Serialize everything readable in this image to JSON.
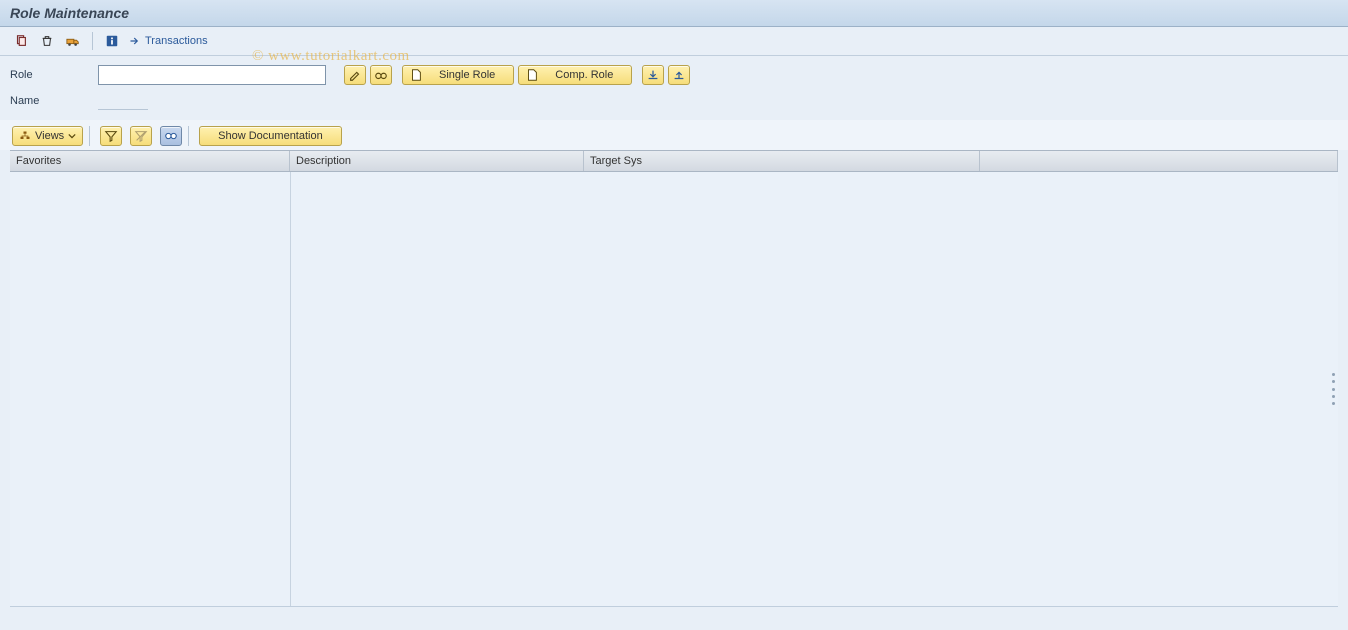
{
  "title": "Role Maintenance",
  "watermark": "© www.tutorialkart.com",
  "toolbar": {
    "transactions_label": "Transactions"
  },
  "form": {
    "role_label": "Role",
    "role_value": "",
    "name_label": "Name",
    "name_value": ""
  },
  "buttons": {
    "single_role": "Single Role",
    "comp_role": "Comp. Role",
    "views": "Views",
    "show_doc": "Show Documentation"
  },
  "table": {
    "col_favorites": "Favorites",
    "col_description": "Description",
    "col_target": "Target Sys"
  }
}
